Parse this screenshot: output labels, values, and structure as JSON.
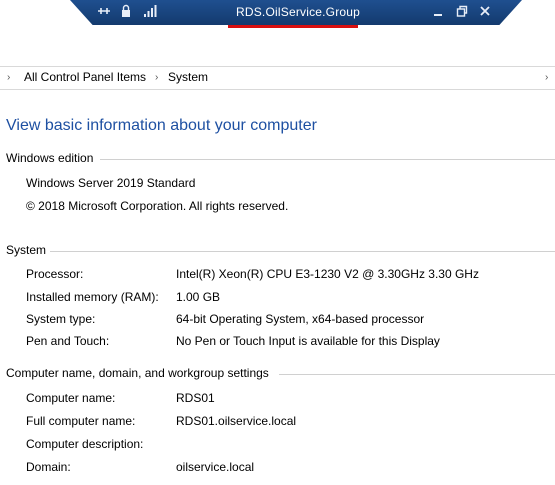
{
  "rdp_bar": {
    "title": "RDS.OilService.Group",
    "icons": [
      "pin-icon",
      "lock-icon",
      "signal-icon",
      "minimize-icon",
      "restore-icon",
      "close-icon"
    ]
  },
  "address_bar": {
    "items": [
      "All Control Panel Items",
      "System"
    ]
  },
  "page_heading": "View basic information about your computer",
  "windows_edition": {
    "label": "Windows edition",
    "edition": "Windows Server 2019 Standard",
    "copyright": "© 2018 Microsoft Corporation. All rights reserved."
  },
  "system": {
    "label": "System",
    "rows": [
      {
        "label": "Processor:",
        "value": "Intel(R) Xeon(R) CPU E3-1230 V2 @ 3.30GHz   3.30 GHz"
      },
      {
        "label": "Installed memory (RAM):",
        "value": "1.00 GB"
      },
      {
        "label": "System type:",
        "value": "64-bit Operating System, x64-based processor"
      },
      {
        "label": "Pen and Touch:",
        "value": "No Pen or Touch Input is available for this Display"
      }
    ]
  },
  "computer_name": {
    "label": "Computer name, domain, and workgroup settings",
    "rows": [
      {
        "label": "Computer name:",
        "value": "RDS01"
      },
      {
        "label": "Full computer name:",
        "value": "RDS01.oilservice.local"
      },
      {
        "label": "Computer description:",
        "value": ""
      },
      {
        "label": "Domain:",
        "value": "oilservice.local"
      }
    ]
  }
}
